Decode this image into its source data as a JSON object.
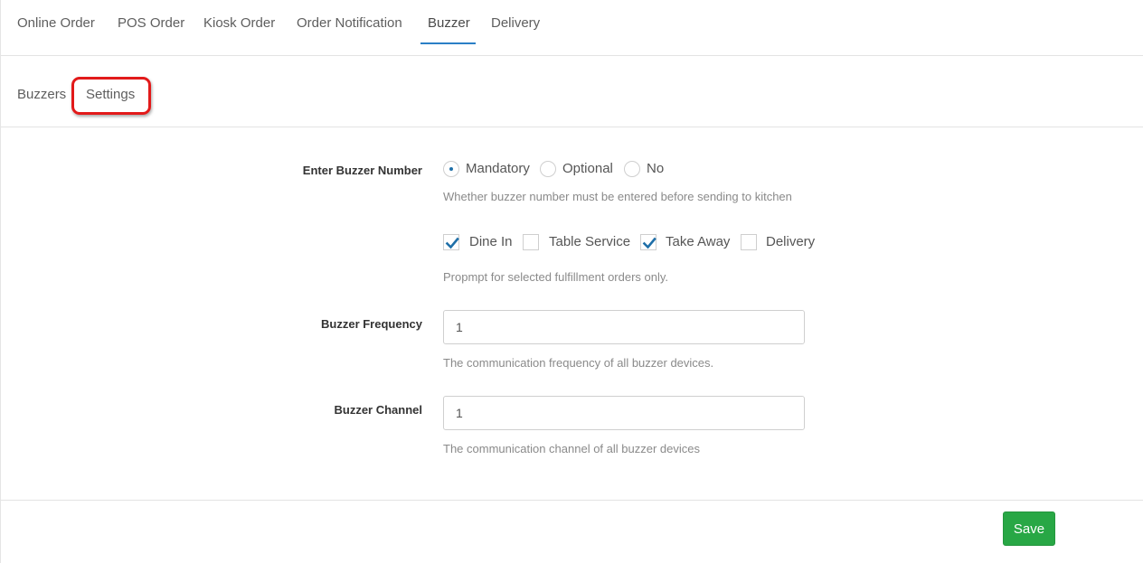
{
  "top_tabs": [
    {
      "label": "Online Order"
    },
    {
      "label": "POS Order"
    },
    {
      "label": "Kiosk Order"
    },
    {
      "label": "Order Notification"
    },
    {
      "label": "Buzzer",
      "active": true
    },
    {
      "label": "Delivery"
    }
  ],
  "sub_tabs": [
    {
      "label": "Buzzers"
    },
    {
      "label": "Settings",
      "highlighted": true
    }
  ],
  "form": {
    "buzzer_number": {
      "label": "Enter Buzzer Number",
      "options": [
        {
          "label": "Mandatory",
          "checked": true
        },
        {
          "label": "Optional",
          "checked": false
        },
        {
          "label": "No",
          "checked": false
        }
      ],
      "help": "Whether buzzer number must be entered before sending to kitchen"
    },
    "fulfillment": {
      "options": [
        {
          "label": "Dine In",
          "checked": true
        },
        {
          "label": "Table Service",
          "checked": false
        },
        {
          "label": "Take Away",
          "checked": true
        },
        {
          "label": "Delivery",
          "checked": false
        }
      ],
      "help": "Propmpt for selected fulfillment orders only."
    },
    "frequency": {
      "label": "Buzzer Frequency",
      "value": "1",
      "help": "The communication frequency of all buzzer devices."
    },
    "channel": {
      "label": "Buzzer Channel",
      "value": "1",
      "help": "The communication channel of all buzzer devices"
    }
  },
  "actions": {
    "save_label": "Save"
  },
  "colors": {
    "accent": "#2b7fc6",
    "save": "#28a745",
    "highlight_ring": "#e21a1a",
    "check": "#1f6fa8"
  }
}
